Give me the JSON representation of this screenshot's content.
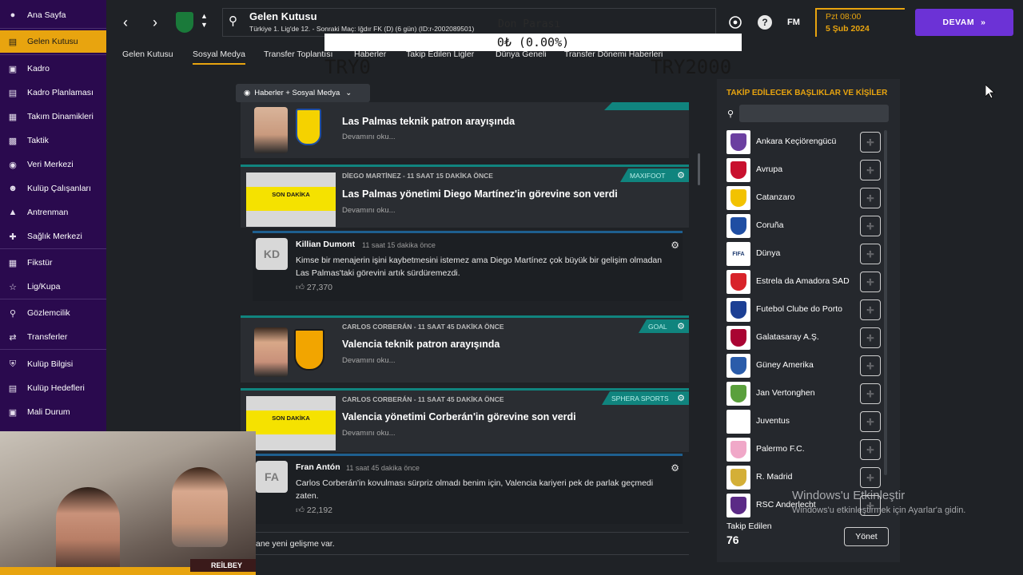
{
  "sidebar": {
    "items": [
      {
        "label": "Ana Sayfa",
        "icon": "home-icon"
      },
      {
        "label": "Gelen Kutusu",
        "icon": "inbox-icon"
      },
      {
        "label": "Kadro",
        "icon": "squad-icon"
      },
      {
        "label": "Kadro Planlaması",
        "icon": "plan-icon"
      },
      {
        "label": "Takım Dinamikleri",
        "icon": "dynamics-icon"
      },
      {
        "label": "Taktik",
        "icon": "tactics-icon"
      },
      {
        "label": "Veri Merkezi",
        "icon": "data-icon"
      },
      {
        "label": "Kulüp Çalışanları",
        "icon": "staff-icon"
      },
      {
        "label": "Antrenman",
        "icon": "training-icon"
      },
      {
        "label": "Sağlık Merkezi",
        "icon": "medical-icon"
      },
      {
        "label": "Fikstür",
        "icon": "calendar-icon"
      },
      {
        "label": "Lig/Kupa",
        "icon": "trophy-icon"
      },
      {
        "label": "Gözlemcilik",
        "icon": "scouting-icon"
      },
      {
        "label": "Transferler",
        "icon": "transfer-icon"
      },
      {
        "label": "Kulüp Bilgisi",
        "icon": "shield-icon"
      },
      {
        "label": "Kulüp Hedefleri",
        "icon": "briefcase-icon"
      },
      {
        "label": "Mali Durum",
        "icon": "money-icon"
      }
    ]
  },
  "header": {
    "title": "Gelen Kutusu",
    "subtitle": "Türkiye 1. Lig'de 12. - Sonraki Maç: Iğdır FK (D) (6 gün) (ID:r-2002089501)",
    "tabs": [
      "Gelen Kutusu",
      "Sosyal Medya",
      "Transfer Toplantısı",
      "Haberler",
      "Takip Edilen Ligler",
      "Dünya Geneli",
      "Transfer Dönemi Haberleri"
    ],
    "time": "Pzt 08:00",
    "date": "5 Şub 2024",
    "continue_label": "DEVAM",
    "fm_label": "FM"
  },
  "overlay": {
    "donation_label": "Don Parası",
    "donation_value": "0₺ (0.00%)",
    "min_label": "TRY0",
    "max_label": "TRY2000"
  },
  "feed": {
    "filter_label": "Haberler + Sosyal Medya",
    "read_more": "Devamını oku...",
    "items": [
      {
        "byline": "",
        "headline": "Las Palmas teknik patron arayışında",
        "source": ""
      },
      {
        "byline": "DİEGO MARTİNEZ  -  11 SAAT 15 DAKİKA ÖNCE",
        "headline": "Las Palmas yönetimi Diego Martínez'in görevine son verdi",
        "source": "MAXIFOOT"
      },
      {
        "byline": "CARLOS CORBERÁN  -  11 SAAT 45 DAKİKA ÖNCE",
        "headline": "Valencia teknik patron arayışında",
        "source": "GOAL"
      },
      {
        "byline": "CARLOS CORBERÁN  -  11 SAAT 45 DAKİKA ÖNCE",
        "headline": "Valencia yönetimi Corberán'in görevine son verdi",
        "source": "SPHERA SPORTS"
      }
    ],
    "breaking_text": "SON DAKİKA",
    "posts": [
      {
        "initials": "KD",
        "name": "Killian Dumont",
        "when": "11 saat 15 dakika önce",
        "text": "Kimse bir menajerin işini kaybetmesini istemez ama Diego Martínez çok büyük bir gelişim olmadan Las Palmas'taki görevini artık sürdüremezdi.",
        "likes": "27,370"
      },
      {
        "initials": "FA",
        "name": "Fran Antón",
        "when": "11 saat 45 dakika önce",
        "text": "Carlos Corberán'in kovulması sürpriz olmadı benim için, Valencia kariyeri pek de parlak geçmedi zaten.",
        "likes": "22,192"
      }
    ],
    "bottom_text": "ane yeni gelişme var."
  },
  "follow": {
    "title": "TAKİP EDİLECEK BAŞLIKLAR VE KİŞİLER",
    "items": [
      {
        "name": "Ankara Keçiörengücü",
        "logo_color": "#6b3fa0",
        "logo_text": ""
      },
      {
        "name": "Avrupa",
        "logo_color": "#c8102e",
        "logo_text": ""
      },
      {
        "name": "Catanzaro",
        "logo_color": "#f2c200",
        "logo_text": ""
      },
      {
        "name": "Coruña",
        "logo_color": "#1f4ea3",
        "logo_text": ""
      },
      {
        "name": "Dünya",
        "logo_color": "#1e3b70",
        "logo_text": "FIFA"
      },
      {
        "name": "Estrela da Amadora SAD",
        "logo_color": "#d8232a",
        "logo_text": ""
      },
      {
        "name": "Futebol Clube do Porto",
        "logo_color": "#1c3f94",
        "logo_text": ""
      },
      {
        "name": "Galatasaray A.Ş.",
        "logo_color": "#a90432",
        "logo_text": ""
      },
      {
        "name": "Güney Amerika",
        "logo_color": "#2a5caa",
        "logo_text": ""
      },
      {
        "name": "Jan Vertonghen",
        "logo_color": "#5aa03c",
        "logo_text": ""
      },
      {
        "name": "Juventus",
        "logo_color": "#ffffff",
        "logo_text": ""
      },
      {
        "name": "Palermo F.C.",
        "logo_color": "#f0a8c8",
        "logo_text": ""
      },
      {
        "name": "R. Madrid",
        "logo_color": "#d4af37",
        "logo_text": ""
      },
      {
        "name": "RSC Anderlecht",
        "logo_color": "#5b2a86",
        "logo_text": ""
      }
    ],
    "followed_label": "Takip Edilen",
    "followed_count": "76",
    "manage_label": "Yönet"
  },
  "windows": {
    "line1": "Windows'u Etkinleştir",
    "line2": "Windows'u etkinleştirmek için Ayarlar'a gidin."
  },
  "webcam": {
    "watermark": "REİLBEY"
  }
}
